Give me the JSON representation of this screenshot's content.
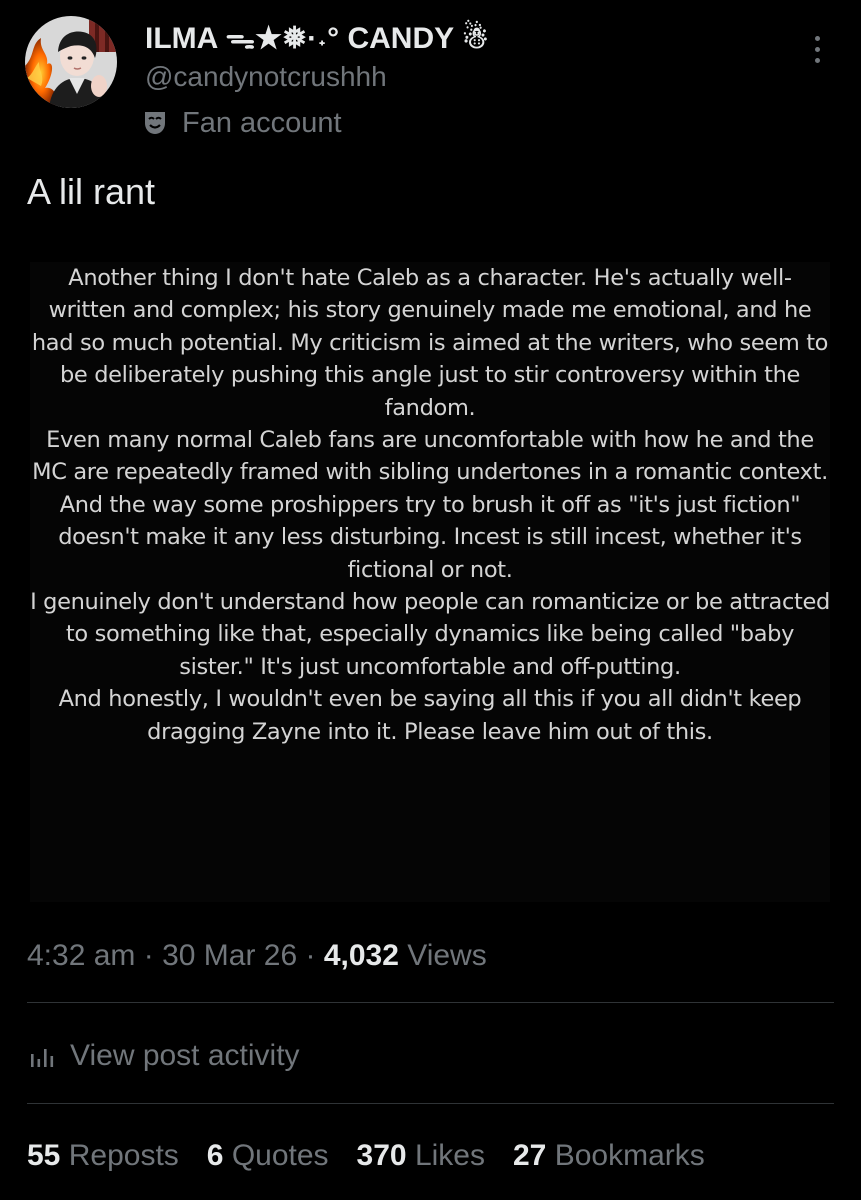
{
  "author": {
    "display_name": "ILMA ᯓ★❅·˖° CANDY ☃︎",
    "handle": "@candynotcrushhh",
    "label": "Fan account",
    "label_icon": "theater-mask-icon",
    "avatar_icon": "profile-avatar"
  },
  "post": {
    "text": "A lil rant",
    "image_text": [
      "Another thing I don't hate Caleb as a character. He's actually well-written and complex; his story genuinely made me emotional, and he had so much potential. My criticism is aimed at the writers, who seem to be deliberately pushing this angle just to stir controversy within the fandom.",
      "Even many normal Caleb fans are uncomfortable with how he and the MC are repeatedly framed with sibling undertones in a romantic context. And the way some proshippers try to brush it off as \"it's just fiction\" doesn't make it any less disturbing. Incest is still incest, whether it's fictional or not.",
      "I genuinely don't understand how people can romanticize or be attracted to something like that, especially dynamics like being called \"baby sister.\" It's just uncomfortable and off-putting.",
      "And honestly, I wouldn't even be saying all this if you all didn't keep dragging Zayne into it. Please leave him out of this."
    ]
  },
  "meta": {
    "time": "4:32 am",
    "separator": " · ",
    "date": "30 Mar 26",
    "views_count": "4,032",
    "views_label": " Views"
  },
  "activity": {
    "label": "View post activity",
    "icon": "bar-chart-icon"
  },
  "stats": [
    {
      "count": "55",
      "label": "Reposts"
    },
    {
      "count": "6",
      "label": "Quotes"
    },
    {
      "count": "370",
      "label": "Likes"
    },
    {
      "count": "27",
      "label": "Bookmarks"
    }
  ],
  "colors": {
    "background": "#000000",
    "primary_text": "#e7e9ea",
    "secondary_text": "#71767b",
    "divider": "#2f3336"
  }
}
